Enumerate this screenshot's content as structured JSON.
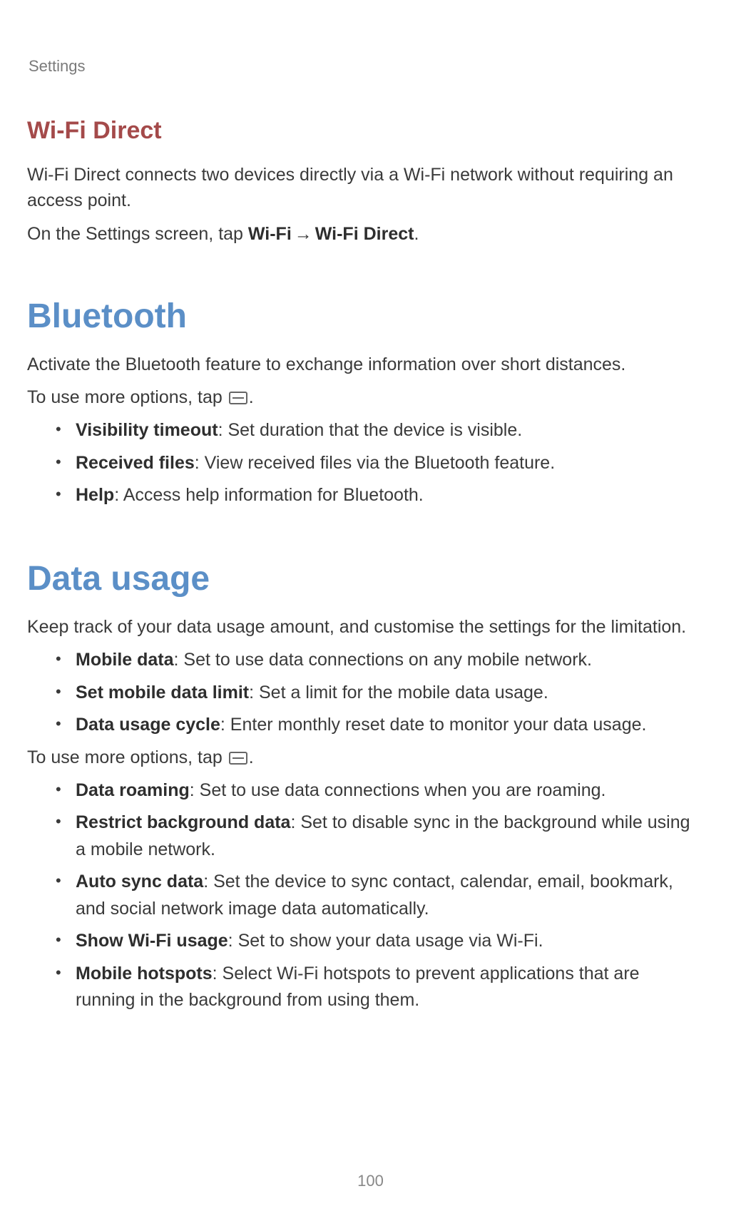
{
  "header": {
    "label": "Settings"
  },
  "wifi_direct": {
    "title": "Wi-Fi Direct",
    "desc": "Wi-Fi Direct connects two devices directly via a Wi-Fi network without requiring an access point.",
    "instruction_prefix": "On the Settings screen, tap ",
    "instruction_b1": "Wi-Fi",
    "instruction_arrow": "→",
    "instruction_b2": "Wi-Fi Direct",
    "instruction_suffix": "."
  },
  "bluetooth": {
    "title": "Bluetooth",
    "desc": "Activate the Bluetooth feature to exchange information over short distances.",
    "options_prefix": "To use more options, tap ",
    "options_suffix": ".",
    "items": [
      {
        "term": "Visibility timeout",
        "desc": ": Set duration that the device is visible."
      },
      {
        "term": "Received files",
        "desc": ": View received files via the Bluetooth feature."
      },
      {
        "term": "Help",
        "desc": ": Access help information for Bluetooth."
      }
    ]
  },
  "data_usage": {
    "title": "Data usage",
    "desc": "Keep track of your data usage amount, and customise the settings for the limitation.",
    "items1": [
      {
        "term": "Mobile data",
        "desc": ": Set to use data connections on any mobile network."
      },
      {
        "term": "Set mobile data limit",
        "desc": ": Set a limit for the mobile data usage."
      },
      {
        "term": "Data usage cycle",
        "desc": ": Enter monthly reset date to monitor your data usage."
      }
    ],
    "options_prefix": "To use more options, tap ",
    "options_suffix": ".",
    "items2": [
      {
        "term": "Data roaming",
        "desc": ": Set to use data connections when you are roaming."
      },
      {
        "term": "Restrict background data",
        "desc": ": Set to disable sync in the background while using a mobile network."
      },
      {
        "term": "Auto sync data",
        "desc": ": Set the device to sync contact, calendar, email, bookmark, and social network image data automatically."
      },
      {
        "term": "Show Wi-Fi usage",
        "desc": ": Set to show your data usage via Wi-Fi."
      },
      {
        "term": "Mobile hotspots",
        "desc": ": Select Wi-Fi hotspots to prevent applications that are running in the background from using them."
      }
    ]
  },
  "page_number": "100"
}
